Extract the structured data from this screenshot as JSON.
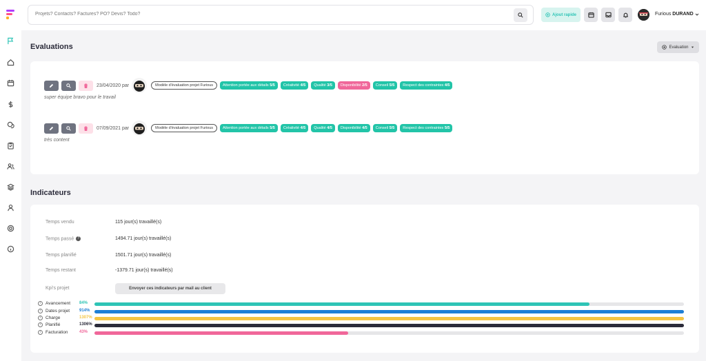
{
  "header": {
    "search_placeholder": "Projets? Contacts? Factures? PO? Devis? Todo?",
    "quick_add_label": "Ajout rapide",
    "user_first": "Furious",
    "user_last": "DURAND"
  },
  "evaluations": {
    "title": "Evaluations",
    "dropdown_label": "Evaluation",
    "items": [
      {
        "date": "23/04/2020 par",
        "model": "Modèle d'évaluation projet Furious",
        "tags": [
          {
            "label": "Attention portée aux détails",
            "score": "5/5",
            "color": "teal"
          },
          {
            "label": "Créativité",
            "score": "4/5",
            "color": "teal"
          },
          {
            "label": "Qualité",
            "score": "3/5",
            "color": "teal"
          },
          {
            "label": "Disponibilité",
            "score": "2/5",
            "color": "pink"
          },
          {
            "label": "Conseil",
            "score": "5/5",
            "color": "teal"
          },
          {
            "label": "Respect des contraintes",
            "score": "4/5",
            "color": "teal"
          }
        ],
        "comment": "super équipe bravo pour le travail"
      },
      {
        "date": "07/09/2021 par",
        "model": "Modèle d'évaluation projet Furious",
        "tags": [
          {
            "label": "Attention portée aux détails",
            "score": "5/5",
            "color": "teal"
          },
          {
            "label": "Créativité",
            "score": "4/5",
            "color": "teal"
          },
          {
            "label": "Qualité",
            "score": "4/5",
            "color": "teal"
          },
          {
            "label": "Disponibilité",
            "score": "4/5",
            "color": "teal"
          },
          {
            "label": "Conseil",
            "score": "5/5",
            "color": "teal"
          },
          {
            "label": "Respect des contraintes",
            "score": "5/5",
            "color": "teal"
          }
        ],
        "comment": "très content"
      }
    ]
  },
  "indicators": {
    "title": "Indicateurs",
    "rows": [
      {
        "label": "Temps vendu",
        "value": "115 jour(s) travaillé(s)"
      },
      {
        "label": "Temps passé",
        "value": "1494.71 jour(s) travaillé(s)"
      },
      {
        "label": "Temps planifié",
        "value": "1501.71 jour(s) travaillé(s)"
      },
      {
        "label": "Temps restant",
        "value": "-1379.71 jour(s) travaillé(s)"
      }
    ],
    "kpi_label": "Kpi's projet",
    "kpi_button": "Envoyer ces indicateurs par mail au client",
    "bars": [
      {
        "name": "Avancement",
        "pct": "84%",
        "fill": 0.84,
        "color": "#2ec4b6"
      },
      {
        "name": "Dates projet",
        "pct": "914%",
        "fill": 1.0,
        "color": "#1e7fd6"
      },
      {
        "name": "Charge",
        "pct": "1307%",
        "fill": 1.0,
        "color": "#f5c542"
      },
      {
        "name": "Planifié",
        "pct": "1306%",
        "fill": 1.0,
        "color": "#2b2b3a"
      },
      {
        "name": "Facturation",
        "pct": "43%",
        "fill": 0.43,
        "color": "#f0679a"
      }
    ]
  }
}
